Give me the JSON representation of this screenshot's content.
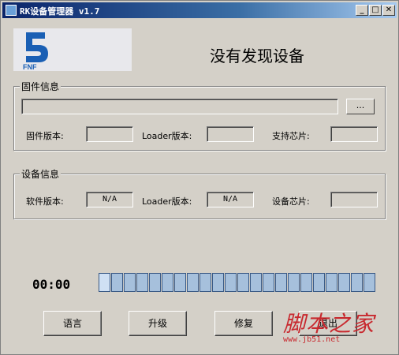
{
  "window": {
    "title": "RK设备管理器 v1.7",
    "minimize_glyph": "_",
    "maximize_glyph": "□",
    "close_glyph": "✕"
  },
  "logo": {
    "text": "FNF"
  },
  "device_status": "没有发现设备",
  "firmware_info": {
    "group_label": "固件信息",
    "browse_label": "...",
    "firmware_version_label": "固件版本:",
    "firmware_version_value": "",
    "loader_version_label": "Loader版本:",
    "loader_version_value": "",
    "supported_chip_label": "支持芯片:",
    "supported_chip_value": ""
  },
  "device_info": {
    "group_label": "设备信息",
    "software_version_label": "软件版本:",
    "software_version_value": "N/A",
    "loader_version_label": "Loader版本:",
    "loader_version_value": "N/A",
    "device_chip_label": "设备芯片:",
    "device_chip_value": ""
  },
  "progress": {
    "time": "00:00",
    "segments": 22
  },
  "buttons": {
    "language": "语言",
    "upgrade": "升级",
    "repair": "修复",
    "exit": "退出"
  },
  "watermark": {
    "text": "脚本之家",
    "url": "www.jb51.net"
  }
}
